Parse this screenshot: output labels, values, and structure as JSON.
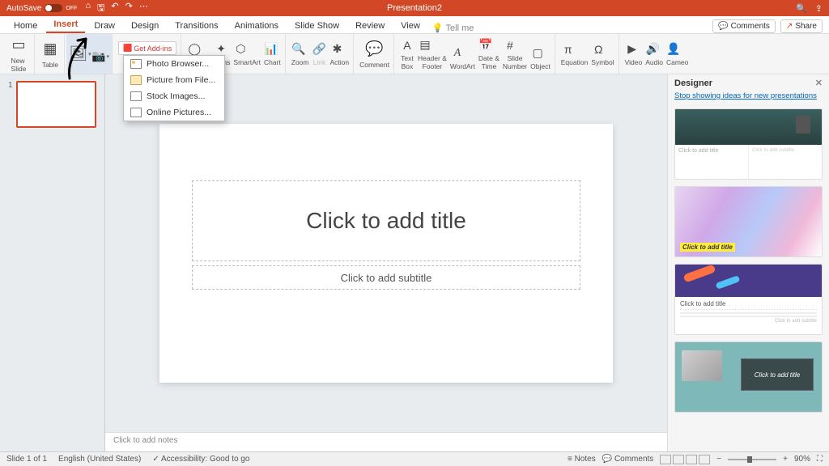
{
  "titlebar": {
    "autosave": "AutoSave",
    "autosave_state": "OFF",
    "doc": "Presentation2"
  },
  "tabs": {
    "home": "Home",
    "insert": "Insert",
    "draw": "Draw",
    "design": "Design",
    "transitions": "Transitions",
    "animations": "Animations",
    "slideshow": "Slide Show",
    "review": "Review",
    "view": "View",
    "tellme": "Tell me",
    "comments": "Comments",
    "share": "Share"
  },
  "ribbon": {
    "new_slide": "New\nSlide",
    "table": "Table",
    "addins_suffix": "dd-ins",
    "get_addins": "Get Add-ins",
    "shapes": "Shapes",
    "icons": "Icons",
    "smartart": "SmartArt",
    "chart": "Chart",
    "zoom": "Zoom",
    "link": "Link",
    "action": "Action",
    "comment": "Comment",
    "textbox": "Text\nBox",
    "header": "Header &\nFooter",
    "wordart": "WordArt",
    "datetime": "Date &\nTime",
    "slidenum": "Slide\nNumber",
    "object": "Object",
    "equation": "Equation",
    "symbol": "Symbol",
    "video": "Video",
    "audio": "Audio",
    "cameo": "Cameo"
  },
  "dropdown": {
    "photo_browser": "Photo Browser...",
    "from_file": "Picture from File...",
    "stock": "Stock Images...",
    "online": "Online Pictures..."
  },
  "slide": {
    "title_ph": "Click to add title",
    "subtitle_ph": "Click to add subtitle"
  },
  "thumb_num": "1",
  "notes": "Click to add notes",
  "designer": {
    "title": "Designer",
    "stop_link": "Stop showing ideas for new presentations",
    "card1_title": "Click to add title",
    "card1_sub": "Click to add subtitle",
    "card2_title": "Click to add title",
    "card3_title": "Click to add title",
    "card3_sub": "Click to add subtitle",
    "card4_title": "Click to add title"
  },
  "status": {
    "slide": "Slide 1 of 1",
    "lang": "English (United States)",
    "access": "Accessibility: Good to go",
    "notes": "Notes",
    "comments": "Comments",
    "zoom": "90%"
  }
}
